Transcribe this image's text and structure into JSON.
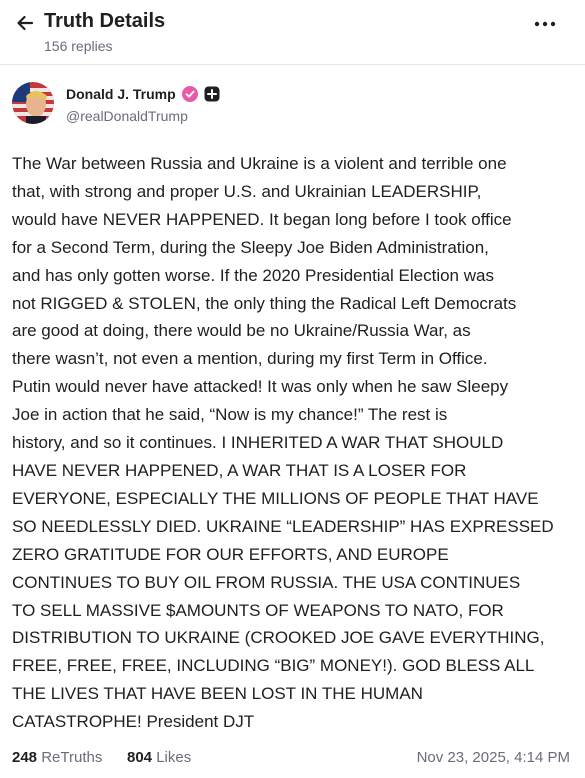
{
  "header": {
    "title": "Truth Details",
    "replies": "156 replies"
  },
  "author": {
    "name": "Donald J. Trump",
    "handle": "@realDonaldTrump"
  },
  "post": {
    "text": "The War between Russia and Ukraine is a violent and terrible one\nthat, with strong and proper U.S. and Ukrainian LEADERSHIP,\nwould have NEVER HAPPENED. It began long before I took office\nfor a Second Term, during the Sleepy Joe Biden Administration,\nand has only gotten worse. If the 2020 Presidential Election was\nnot RIGGED & STOLEN, the only thing the Radical Left Democrats\nare good at doing, there would be no Ukraine/Russia War, as\nthere wasn’t, not even a mention, during my first Term in Office.\nPutin would never have attacked! It was only when he saw Sleepy\nJoe in action that he said, “Now is my chance!” The rest is\nhistory, and so it continues. I INHERITED A WAR THAT SHOULD\nHAVE NEVER HAPPENED, A WAR THAT IS A LOSER FOR\nEVERYONE, ESPECIALLY THE MILLIONS OF PEOPLE THAT HAVE\nSO NEEDLESSLY DIED. UKRAINE “LEADERSHIP” HAS EXPRESSED\nZERO GRATITUDE FOR OUR EFFORTS, AND EUROPE\nCONTINUES TO BUY OIL FROM RUSSIA. THE USA CONTINUES\nTO SELL MASSIVE $AMOUNTS OF WEAPONS TO NATO, FOR\nDISTRIBUTION TO UKRAINE (CROOKED JOE GAVE EVERYTHING,\nFREE, FREE, FREE, INCLUDING “BIG” MONEY!). GOD BLESS ALL\nTHE LIVES THAT HAVE BEEN LOST IN THE HUMAN\nCATASTROPHE! President DJT"
  },
  "stats": {
    "retruths_count": "248",
    "retruths_label": "ReTruths",
    "likes_count": "804",
    "likes_label": "Likes",
    "timestamp": "Nov 23, 2025, 4:14 PM"
  },
  "icons": {
    "back": "arrow-left-icon",
    "more": "more-horizontal-icon",
    "verified": "verified-badge-icon",
    "plus": "plus-badge-icon"
  },
  "colors": {
    "verified_badge": "#e85aa6",
    "text_primary": "#1f1f23",
    "text_secondary": "#6b6b7b"
  }
}
